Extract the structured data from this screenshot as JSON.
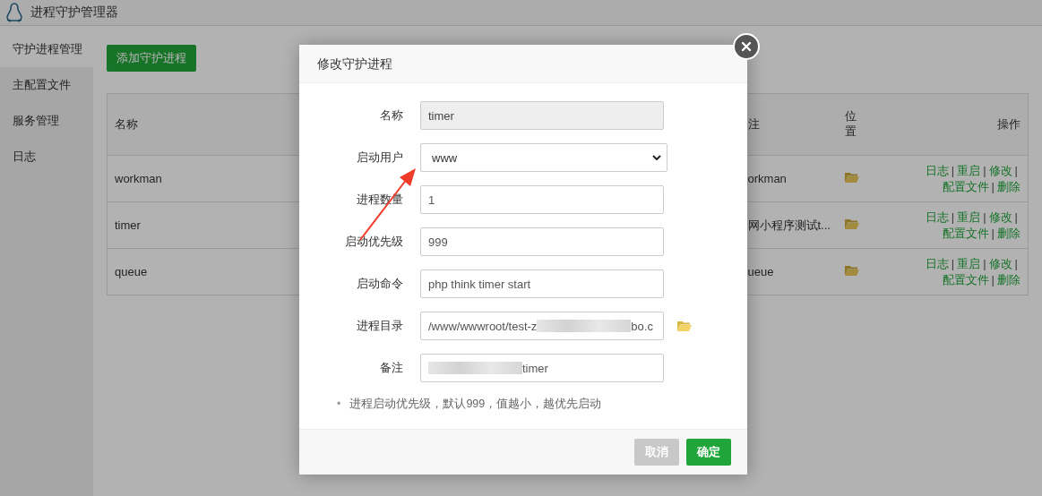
{
  "app": {
    "title": "进程守护管理器"
  },
  "sidebar": {
    "items": [
      {
        "label": "守护进程管理",
        "selected": true
      },
      {
        "label": "主配置文件",
        "selected": false
      },
      {
        "label": "服务管理",
        "selected": false
      },
      {
        "label": "日志",
        "selected": false
      }
    ]
  },
  "add_button": "添加守护进程",
  "table": {
    "columns": [
      "名称",
      "注",
      "位置",
      "操作"
    ],
    "separator": "|",
    "rows": [
      {
        "name": "workman",
        "remark": "orkman",
        "actions": [
          "日志",
          "重启",
          "修改",
          "配置文件",
          "删除"
        ]
      },
      {
        "name": "timer",
        "remark": "网小程序测试t...",
        "actions": [
          "日志",
          "重启",
          "修改",
          "配置文件",
          "删除"
        ]
      },
      {
        "name": "queue",
        "remark": "ueue",
        "actions": [
          "日志",
          "重启",
          "修改",
          "配置文件",
          "删除"
        ]
      }
    ]
  },
  "dialog": {
    "title": "修改守护进程",
    "fields": [
      {
        "label": "名称",
        "kind": "text",
        "value": "timer",
        "disabled": true
      },
      {
        "label": "启动用户",
        "kind": "select",
        "value": "www",
        "disabled": false
      },
      {
        "label": "进程数量",
        "kind": "text",
        "value": "1",
        "disabled": false
      },
      {
        "label": "启动优先级",
        "kind": "text",
        "value": "999",
        "disabled": false
      },
      {
        "label": "启动命令",
        "kind": "text",
        "value": "php think timer start",
        "disabled": false
      },
      {
        "label": "进程目录",
        "kind": "path",
        "value": "/www/wwwroot/test-z",
        "redacted": true,
        "value_after": "bo.c",
        "disabled": false
      },
      {
        "label": "备注",
        "kind": "text",
        "redacted": true,
        "value_after": "timer",
        "disabled": false
      }
    ],
    "notes": [
      {
        "marker": "•",
        "text": "进程启动优先级，默认999，值越小，越优先启动"
      }
    ],
    "buttons": [
      {
        "label": "取消",
        "kind": "cancel"
      },
      {
        "label": "确定",
        "kind": "primary"
      }
    ]
  }
}
